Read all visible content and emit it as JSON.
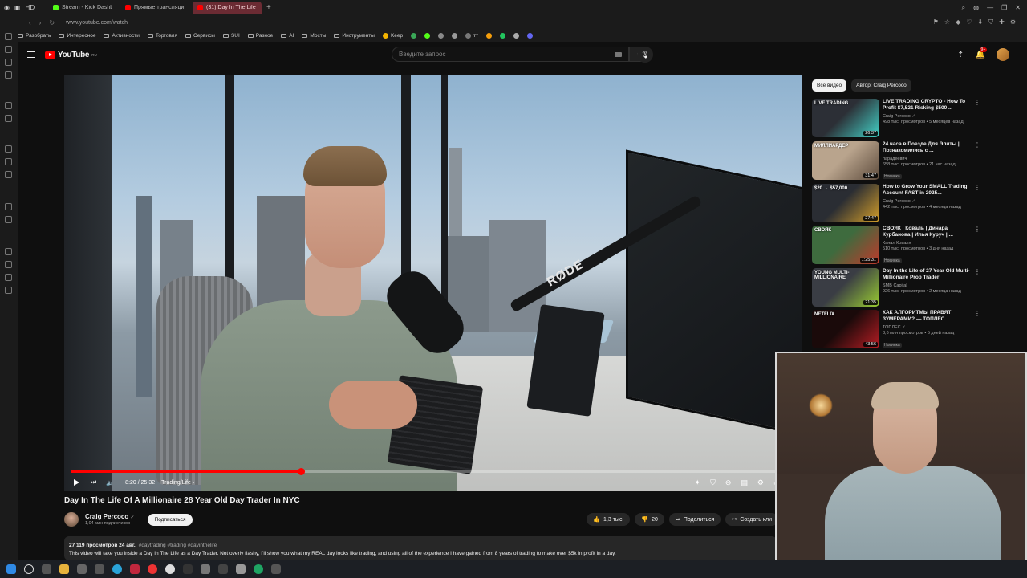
{
  "browser": {
    "tabs": [
      {
        "label": "Stream - Kick Dashbo",
        "color": "#53fc18",
        "active": false
      },
      {
        "label": "Прямые трансляции - Y",
        "color": "#ff0000",
        "active": false
      },
      {
        "label": "(31) Day In The Life Of A",
        "color": "#ff0000",
        "active": true
      }
    ],
    "url": "www.youtube.com/watch",
    "hd_label": "HD",
    "bookmarks": [
      {
        "label": "Разобрать",
        "kind": "folder"
      },
      {
        "label": "Интересное",
        "kind": "folder"
      },
      {
        "label": "Активности",
        "kind": "folder"
      },
      {
        "label": "Торговля",
        "kind": "folder"
      },
      {
        "label": "Сервисы",
        "kind": "folder"
      },
      {
        "label": "SUI",
        "kind": "folder"
      },
      {
        "label": "Разное",
        "kind": "folder"
      },
      {
        "label": "AI",
        "kind": "folder"
      },
      {
        "label": "Мосты",
        "kind": "folder"
      },
      {
        "label": "Инструменты",
        "kind": "folder"
      },
      {
        "label": "Keep",
        "kind": "app"
      },
      {
        "label": "тт",
        "kind": "app"
      }
    ]
  },
  "youtube": {
    "logo_text": "YouTube",
    "logo_region": "RU",
    "search_placeholder": "Введите запрос",
    "notifications_badge": "9+",
    "video": {
      "title": "Day In The Life Of A Millionaire 28 Year Old Day Trader In NYC",
      "time": "8:20 / 25:32",
      "chapter": "Trading/Life",
      "chapter_arrow": "›",
      "progress": 0.326
    },
    "channel": {
      "name": "Craig Percoco",
      "verified": "✓",
      "subs": "1,04 млн подписчиков",
      "subscribe_label": "Подписаться"
    },
    "actions": {
      "likes": "1,3 тыс.",
      "dislikes": "20",
      "share": "Поделиться",
      "create_clip": "Создать кли"
    },
    "description": {
      "views_date": "27 119 просмотров  24 авг.",
      "tags": "#daytrading #trading #dayinthelife",
      "text": "This video will take you inside a Day In The Life as a Day Trader. Not overly flashy, I'll show you what my REAL day looks like trading, and using all of the experience I have gained from 8 years of trading to make over $5k in profit in a day."
    },
    "chips": [
      "Все видео",
      "Автор: Craig Percoco"
    ],
    "recommendations": [
      {
        "title": "LIVE TRADING CRYPTO - How To Profit $7,521 Risking $500 ...",
        "channel": "Craig Percoco ✓",
        "stats": "498 тыс. просмотров • 5 месяцев назад",
        "duration": "26:37",
        "thumb_text": "LIVE TRADING",
        "new": "",
        "color1": "#2c2f36",
        "color2": "#43d3c8"
      },
      {
        "title": "24 часа в Поезде Для Элиты | Познакомились с ...",
        "channel": "парадеевич",
        "stats": "658 тыс. просмотров • 21 час назад",
        "duration": "31:47",
        "thumb_text": "МИЛЛИАРДЕР",
        "new": "Новинка",
        "color1": "#b9a48d",
        "color2": "#5d4b3c"
      },
      {
        "title": "How to Grow Your SMALL Trading Account FAST in 2025...",
        "channel": "Craig Percoco ✓",
        "stats": "442 тыс. просмотров • 4 месяца назад",
        "duration": "27:47",
        "thumb_text": "$20 → $57,000",
        "new": "",
        "color1": "#2a2d33",
        "color2": "#d6a02a"
      },
      {
        "title": "СВОЯК | Коваль | Динара Курбанова | Илья Куруч | ...",
        "channel": "Канал Коваля",
        "stats": "510 тыс. просмотров • 3 дня назад",
        "duration": "1:25:31",
        "thumb_text": "СВОЯК",
        "new": "Новинка",
        "color1": "#3e6b3e",
        "color2": "#c0392b"
      },
      {
        "title": "Day In the Life of 27 Year Old Multi-Millionaire Prop Trader",
        "channel": "SMB Capital",
        "stats": "926 тыс. просмотров • 2 месяца назад",
        "duration": "21:35",
        "thumb_text": "YOUNG MULTI-MILLIONAIRE",
        "new": "",
        "color1": "#3a3d44",
        "color2": "#9acd32"
      },
      {
        "title": "КАК АЛГОРИТМЫ ПРАВЯТ ЗУМЕРАМИ? — ТОПЛЕС",
        "channel": "ТОПЛЕС ✓",
        "stats": "3,6 млн просмотров • 5 дней назад",
        "duration": "43:56",
        "thumb_text": "NETFLIX",
        "new": "Новинка",
        "color1": "#1a0a0a",
        "color2": "#b81d24"
      }
    ]
  }
}
